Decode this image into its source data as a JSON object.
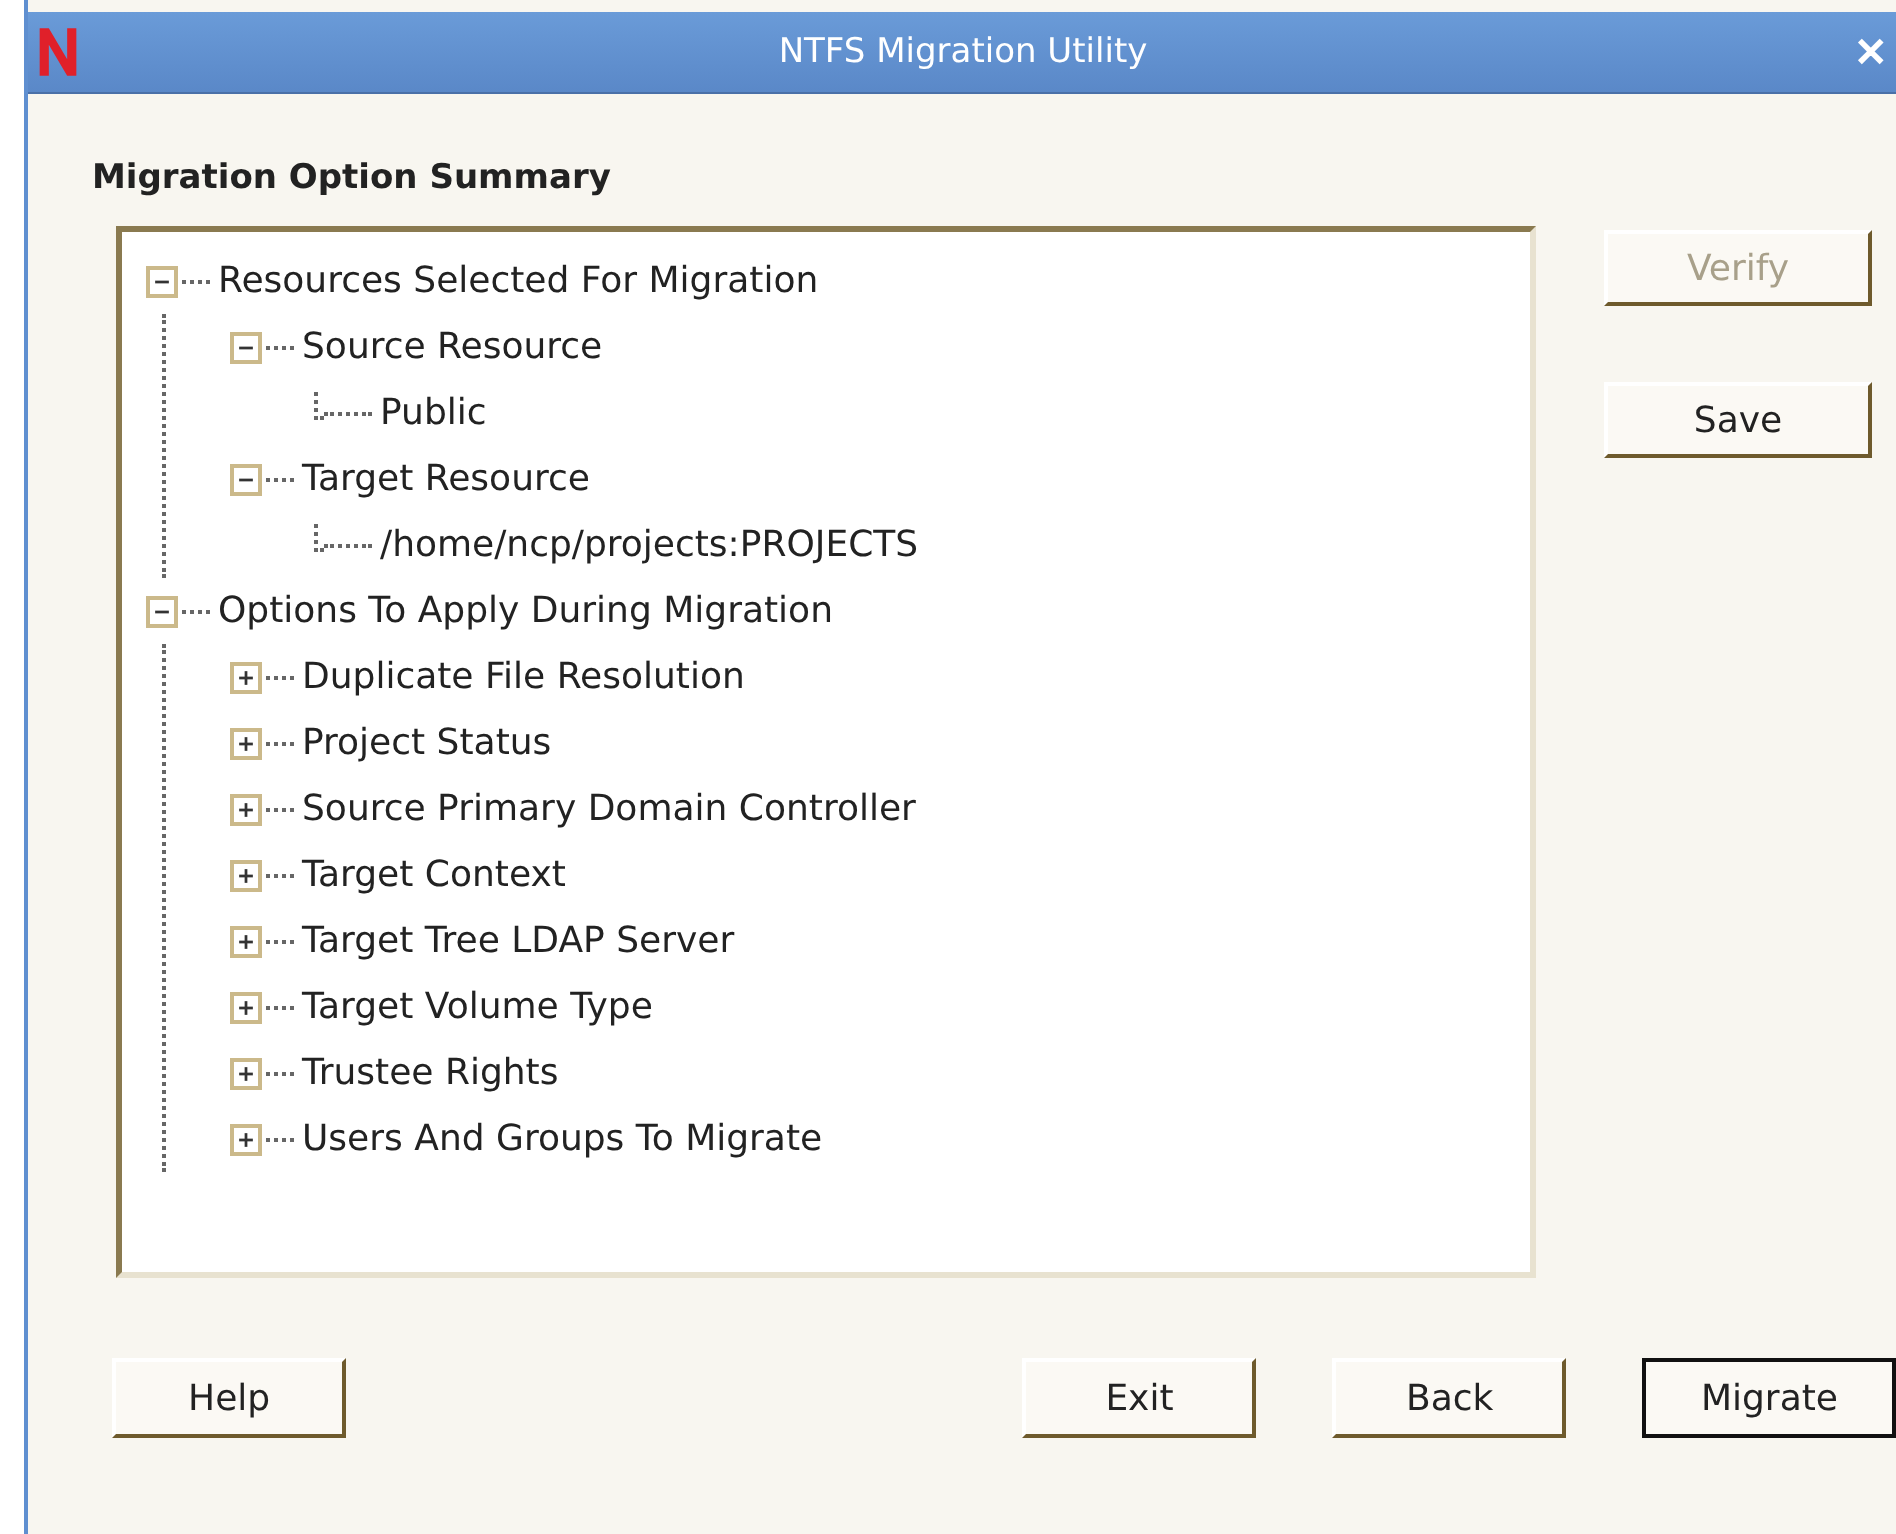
{
  "window": {
    "title": "NTFS Migration Utility",
    "close": "✕"
  },
  "heading": "Migration Option Summary",
  "tree": [
    {
      "label": "Resources Selected For Migration",
      "expanded": true,
      "children": [
        {
          "label": "Source Resource",
          "expanded": true,
          "children": [
            {
              "label": "Public"
            }
          ]
        },
        {
          "label": "Target Resource",
          "expanded": true,
          "children": [
            {
              "label": "/home/ncp/projects:PROJECTS"
            }
          ]
        }
      ]
    },
    {
      "label": "Options To Apply During Migration",
      "expanded": true,
      "children": [
        {
          "label": "Duplicate File Resolution",
          "expanded": false
        },
        {
          "label": "Project Status",
          "expanded": false
        },
        {
          "label": "Source Primary Domain Controller",
          "expanded": false
        },
        {
          "label": "Target Context",
          "expanded": false
        },
        {
          "label": "Target Tree LDAP Server",
          "expanded": false
        },
        {
          "label": "Target Volume Type",
          "expanded": false
        },
        {
          "label": "Trustee Rights",
          "expanded": false
        },
        {
          "label": "Users And Groups To Migrate",
          "expanded": false
        }
      ]
    }
  ],
  "side_buttons": [
    {
      "label": "Verify",
      "disabled": true
    },
    {
      "label": "Save",
      "disabled": false
    }
  ],
  "bottom_buttons": [
    {
      "label": "Help",
      "default": false
    },
    {
      "label": "Exit",
      "default": false
    },
    {
      "label": "Back",
      "default": false
    },
    {
      "label": "Migrate",
      "default": true
    }
  ]
}
